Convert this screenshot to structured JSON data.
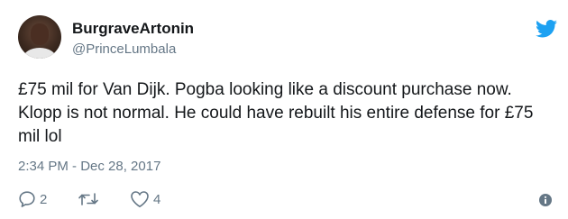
{
  "user": {
    "display_name": "BurgraveArtonin",
    "handle": "@PrinceLumbala"
  },
  "tweet": {
    "text": "£75 mil for Van Dijk. Pogba looking like a discount purchase now. Klopp is not normal. He could have rebuilt his entire defense for £75 mil lol",
    "timestamp": "2:34 PM - Dec 28, 2017"
  },
  "actions": {
    "reply_count": "2",
    "retweet_count": "",
    "like_count": "4"
  },
  "icons": {
    "brand": "twitter-bird-icon",
    "reply": "reply-icon",
    "retweet": "retweet-icon",
    "like": "heart-icon",
    "info": "info-icon"
  },
  "colors": {
    "brand": "#1da1f2",
    "text": "#14171a",
    "muted": "#657786"
  }
}
